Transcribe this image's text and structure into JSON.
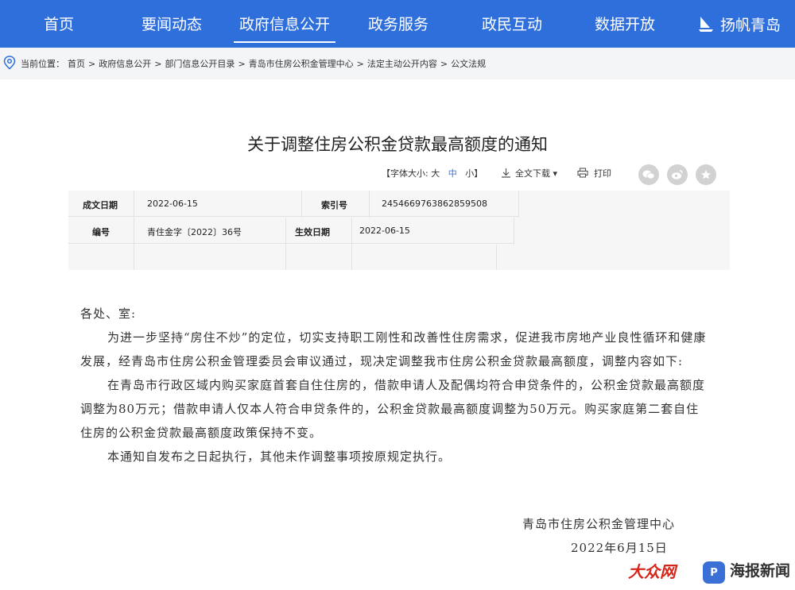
{
  "nav": {
    "items": [
      "首页",
      "要闻动态",
      "政府信息公开",
      "政务服务",
      "政民互动",
      "数据开放"
    ],
    "active_index": 2,
    "brand": "扬帆青岛",
    "bg_color": "#2f6fdc"
  },
  "breadcrumb": {
    "prefix": "当前位置：",
    "items": [
      "首页",
      "政府信息公开",
      "部门信息公开目录",
      "青岛市住房公积金管理中心",
      "法定主动公开内容",
      "公文法规"
    ],
    "separator": ">"
  },
  "article": {
    "title": "关于调整住房公积金贷款最高额度的通知"
  },
  "toolbar": {
    "font_size_label": "【字体大小:",
    "font_large": "大",
    "font_medium": "中",
    "font_small": "小】",
    "download": "全文下载",
    "print": "打印"
  },
  "meta": {
    "created_date_label": "成文日期",
    "created_date": "2022-06-15",
    "index_label": "索引号",
    "index": "2454669763862859508",
    "number_label": "编号",
    "number": "青住金字〔2022〕36号",
    "effective_label": "生效日期",
    "effective_date": "2022-06-15"
  },
  "body": {
    "greeting": "各处、室:",
    "para1": "为进一步坚持“房住不炒”的定位，切实支持职工刚性和改善性住房需求，促进我市房地产业良性循环和健康发展，经青岛市住房公积金管理委员会审议通过，现决定调整我市住房公积金贷款最高额度，调整内容如下:",
    "para2": "在青岛市行政区域内购买家庭首套自住住房的，借款申请人及配偶均符合申贷条件的，公积金贷款最高额度调整为80万元；借款申请人仅本人符合申贷条件的，公积金贷款最高额度调整为50万元。购买家庭第二套自住住房的公积金贷款最高额度政策保持不变。",
    "para3": "本通知自发布之日起执行，其他未作调整事项按原规定执行。"
  },
  "signature": {
    "org": "青岛市住房公积金管理中心",
    "date": "2022年6月15日"
  },
  "watermarks": {
    "dzwww": "大众网",
    "haibao": "海报新闻",
    "haibao_icon": "P"
  }
}
